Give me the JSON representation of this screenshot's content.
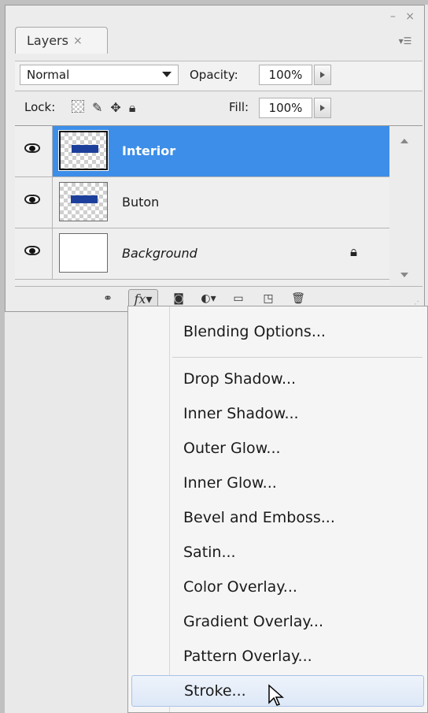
{
  "panel": {
    "tab_label": "Layers",
    "tab_close": "×",
    "window_controls": "– ×",
    "blend_mode": "Normal",
    "opacity_label": "Opacity:",
    "opacity_value": "100%",
    "lock_label": "Lock:",
    "fill_label": "Fill:",
    "fill_value": "100%"
  },
  "layers": [
    {
      "name": "Interior",
      "selected": true,
      "visible": true
    },
    {
      "name": "Buton",
      "selected": false,
      "visible": true
    },
    {
      "name": "Background",
      "selected": false,
      "visible": true,
      "locked": true
    }
  ],
  "footer": {
    "fx_label": "fx"
  },
  "menu": {
    "items": [
      "Blending Options...",
      "Drop Shadow...",
      "Inner Shadow...",
      "Outer Glow...",
      "Inner Glow...",
      "Bevel and Emboss...",
      "Satin...",
      "Color Overlay...",
      "Gradient Overlay...",
      "Pattern Overlay...",
      "Stroke..."
    ],
    "hovered_item": "Stroke..."
  },
  "colors": {
    "selection": "#3d8ee8",
    "layer_fill": "#1d3f9c",
    "menu_hover": "#dde8f7"
  }
}
